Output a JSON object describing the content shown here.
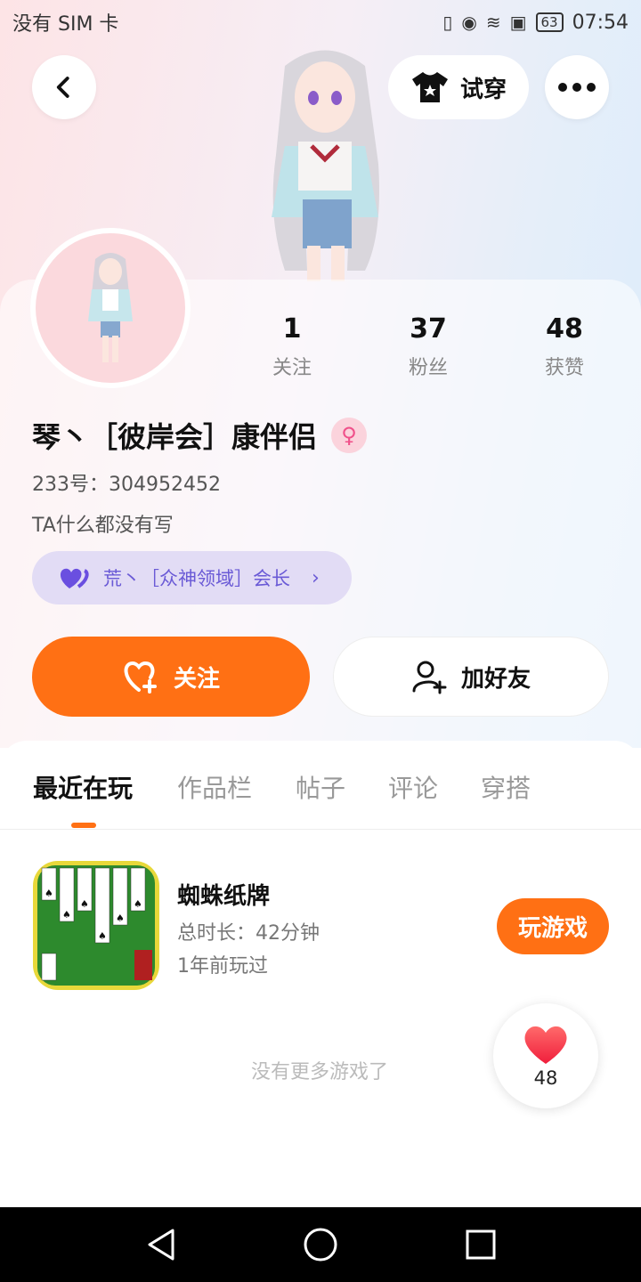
{
  "status_bar": {
    "carrier": "没有 SIM 卡",
    "battery": "63",
    "time": "07:54"
  },
  "header": {
    "back_icon": "chevron-left-icon",
    "try_on_label": "试穿",
    "more_icon": "more-horizontal-icon"
  },
  "profile": {
    "stats": [
      {
        "value": "1",
        "label": "关注"
      },
      {
        "value": "37",
        "label": "粉丝"
      },
      {
        "value": "48",
        "label": "获赞"
      }
    ],
    "name": "琴丶［彼岸会］康伴侣",
    "gender_icon": "female-icon",
    "id_text": "233号：304952452",
    "bio": "TA什么都没有写",
    "guild_label": "荒丶［众神领域］会长"
  },
  "actions": {
    "follow_label": "关注",
    "add_friend_label": "加好友"
  },
  "tabs": [
    "最近在玩",
    "作品栏",
    "帖子",
    "评论",
    "穿搭"
  ],
  "active_tab": 0,
  "games": [
    {
      "name": "蜘蛛纸牌",
      "duration": "总时长：42分钟",
      "last_played": "1年前玩过",
      "play_label": "玩游戏"
    }
  ],
  "no_more_text": "没有更多游戏了",
  "like_count": "48",
  "colors": {
    "accent": "#ff7014",
    "guild_bg": "#e2dcf5",
    "guild_text": "#6a5ad6"
  }
}
